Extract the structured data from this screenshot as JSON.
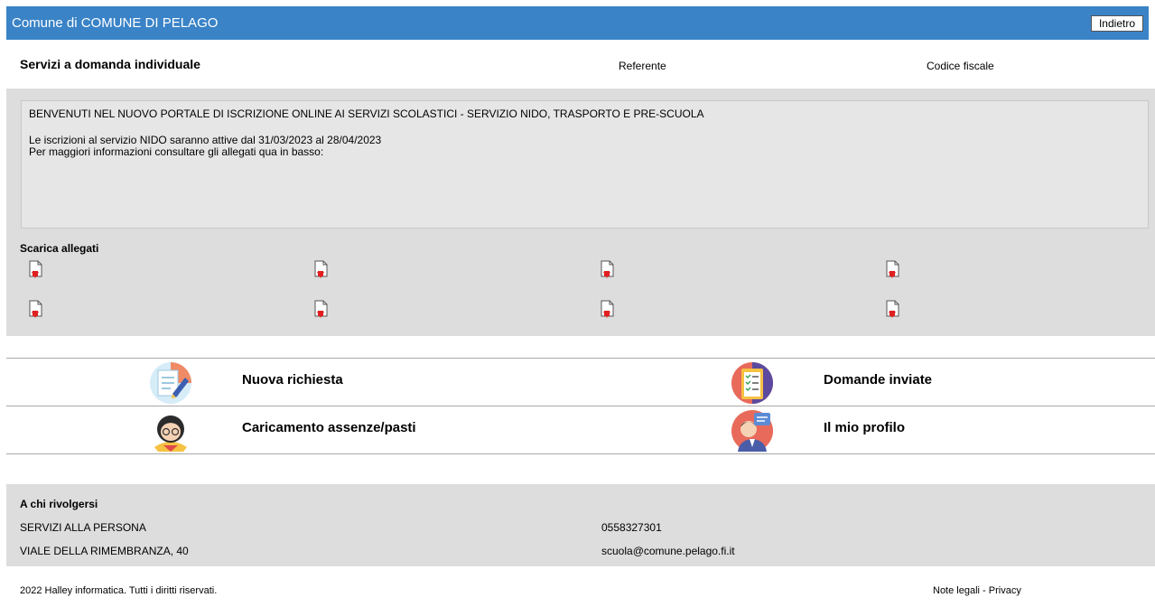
{
  "header": {
    "title": "Comune di COMUNE DI PELAGO",
    "back_label": "Indietro"
  },
  "service_row": {
    "title": "Servizi a domanda individuale",
    "referente_label": "Referente",
    "codice_fiscale_label": "Codice fiscale"
  },
  "notice": {
    "line1": "BENVENUTI NEL NUOVO PORTALE DI ISCRIZIONE ONLINE AI SERVIZI SCOLASTICI - SERVIZIO NIDO, TRASPORTO E PRE-SCUOLA",
    "line2": "Le iscrizioni al servizio NIDO saranno attive dal 31/03/2023 al 28/04/2023",
    "line3": "Per maggiori informazioni consultare gli allegati qua in basso:"
  },
  "attachments": {
    "title": "Scarica allegati",
    "icon": "pdf-download-icon"
  },
  "actions": {
    "new_request": "Nuova richiesta",
    "sent_requests": "Domande inviate",
    "absences": "Caricamento assenze/pasti",
    "profile": "Il mio profilo"
  },
  "contact": {
    "title": "A chi rivolgersi",
    "office": "SERVIZI ALLA PERSONA",
    "address": "VIALE DELLA RIMEMBRANZA, 40",
    "phone": "0558327301",
    "email": "scuola@comune.pelago.fi.it"
  },
  "footer": {
    "copyright": "2022 Halley informatica. Tutti i diritti riservati.",
    "legal": "Note legali",
    "separator": " - ",
    "privacy": "Privacy"
  },
  "colors": {
    "header_blue": "#3a83c7",
    "panel_gray": "#dddddd",
    "download_red": "#e02020"
  }
}
